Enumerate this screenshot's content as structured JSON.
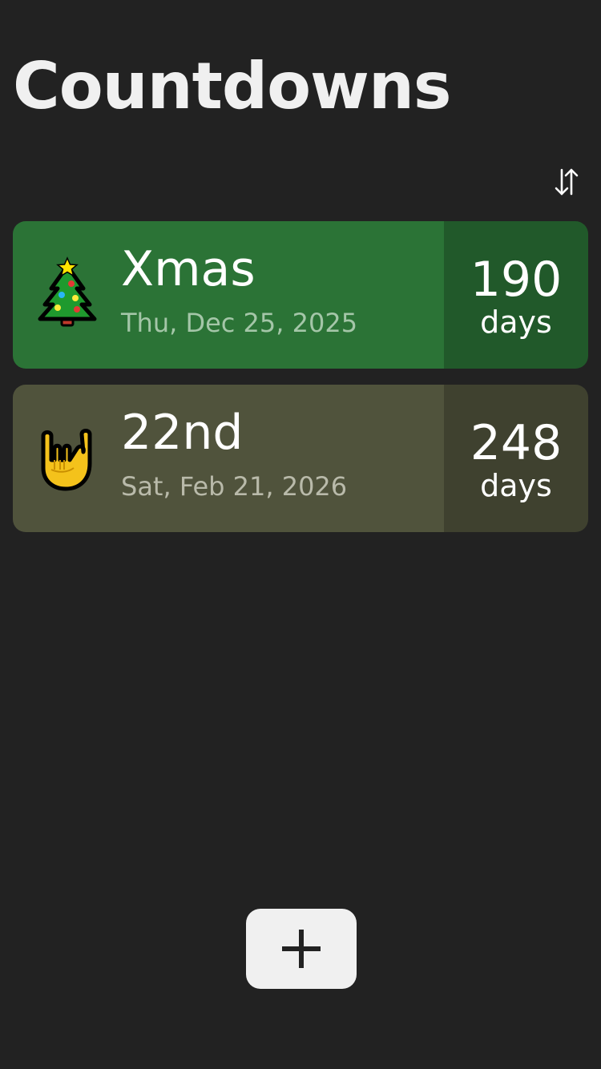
{
  "header": {
    "title": "Countdowns"
  },
  "toolbar": {
    "sort_icon": "sort-arrows-icon"
  },
  "countdowns": [
    {
      "name": "Xmas",
      "date": "Thu, Dec 25, 2025",
      "days": "190",
      "days_label": "days",
      "icon": "christmas-tree-icon",
      "color_main": "#2b7336",
      "color_days": "#21592a",
      "color_date": "#a4c6a8"
    },
    {
      "name": "22nd",
      "date": "Sat, Feb 21, 2026",
      "days": "248",
      "days_label": "days",
      "icon": "rock-on-hand-icon",
      "color_main": "#50533c",
      "color_days": "#3f412f",
      "color_date": "#b9baaa"
    }
  ],
  "add_button": {
    "icon": "plus-icon"
  }
}
